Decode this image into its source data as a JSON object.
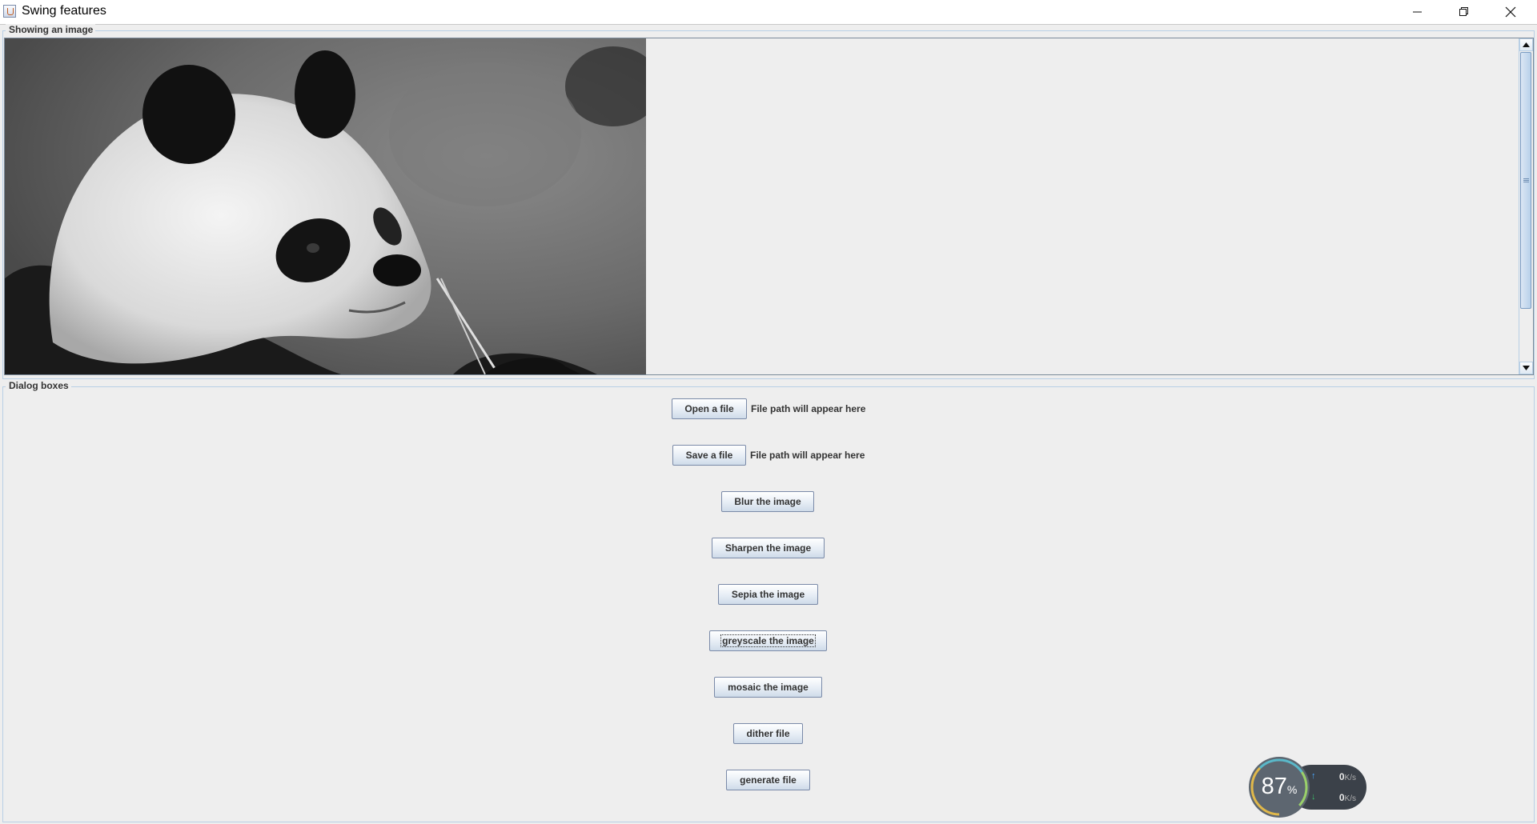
{
  "window": {
    "title": "Swing features",
    "icon": "java-cup-icon",
    "controls": [
      "minimize-icon",
      "restore-icon",
      "close-icon"
    ]
  },
  "image_panel": {
    "title": "Showing an image",
    "image_description_icon": "panda-photo"
  },
  "dialog_panel": {
    "title": "Dialog boxes",
    "open_button": "Open a file",
    "open_path": "File path will appear here",
    "save_button": "Save a file",
    "save_path": "File path will appear here",
    "blur_button": "Blur the image",
    "sharpen_button": "Sharpen the image",
    "sepia_button": "Sepia the image",
    "greyscale_button": "greyscale the image",
    "mosaic_button": "mosaic the image",
    "dither_button": "dither file",
    "generate_button": "generate file"
  },
  "network_widget": {
    "percent": "87",
    "percent_sign": "%",
    "upload_value": "0",
    "upload_unit": "K/s",
    "download_value": "0",
    "download_unit": "K/s",
    "upload_color": "#4aa8ff",
    "download_color": "#3cc46a"
  }
}
